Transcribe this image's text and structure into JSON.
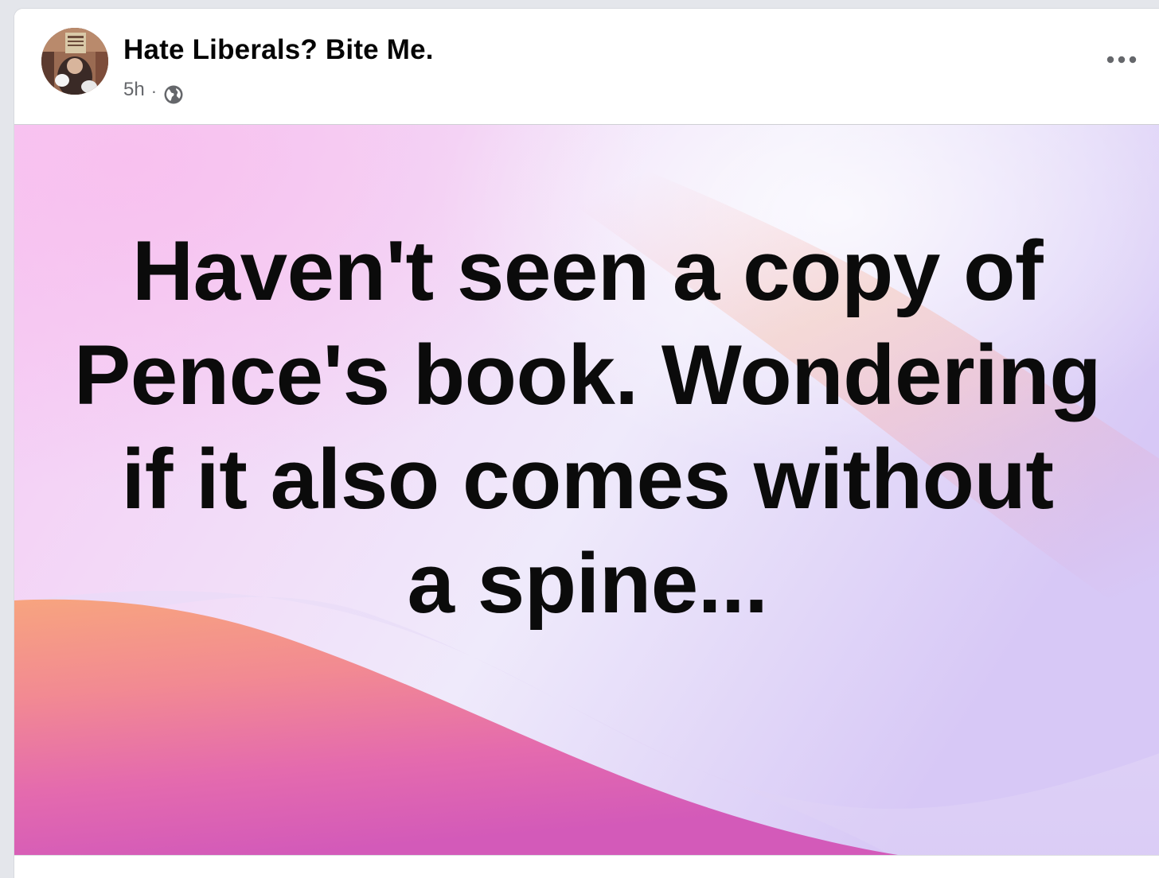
{
  "post": {
    "author": "Hate Liberals? Bite Me.",
    "timestamp": "5h",
    "separator": "·",
    "audience_icon": "globe-icon",
    "more_icon": "more-options-icon"
  },
  "image": {
    "text": "Haven't seen a copy of\nPence's book. Wondering\nif it also comes without\na spine...",
    "colors": {
      "top": "#f3ccf5",
      "light": "#f0e9fb",
      "lavender": "#d8c9f6",
      "peach": "#f5a27f",
      "pink": "#ee74b4",
      "magenta": "#d65ab9"
    }
  }
}
